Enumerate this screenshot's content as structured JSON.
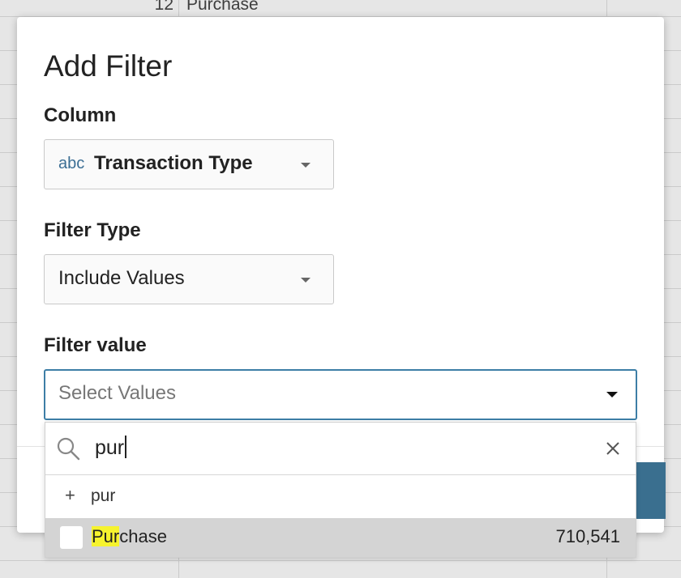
{
  "background": {
    "row_number": "12",
    "row_value": "Purchase"
  },
  "modal": {
    "title": "Add Filter",
    "column": {
      "label": "Column",
      "type_tag": "abc",
      "value": "Transaction Type"
    },
    "filter_type": {
      "label": "Filter Type",
      "value": "Include Values"
    },
    "filter_value": {
      "label": "Filter value",
      "placeholder": "Select Values"
    }
  },
  "dropdown": {
    "search_query": "pur",
    "add_option_symbol": "+",
    "add_option_label": "pur",
    "options": [
      {
        "match": "Pur",
        "rest": "chase",
        "count": "710,541",
        "checked": false
      }
    ]
  },
  "colors": {
    "accent": "#3d7ea6",
    "primary_button": "#3a6f8f",
    "highlight": "#f6f32e",
    "type_tag": "#3b6e94"
  }
}
